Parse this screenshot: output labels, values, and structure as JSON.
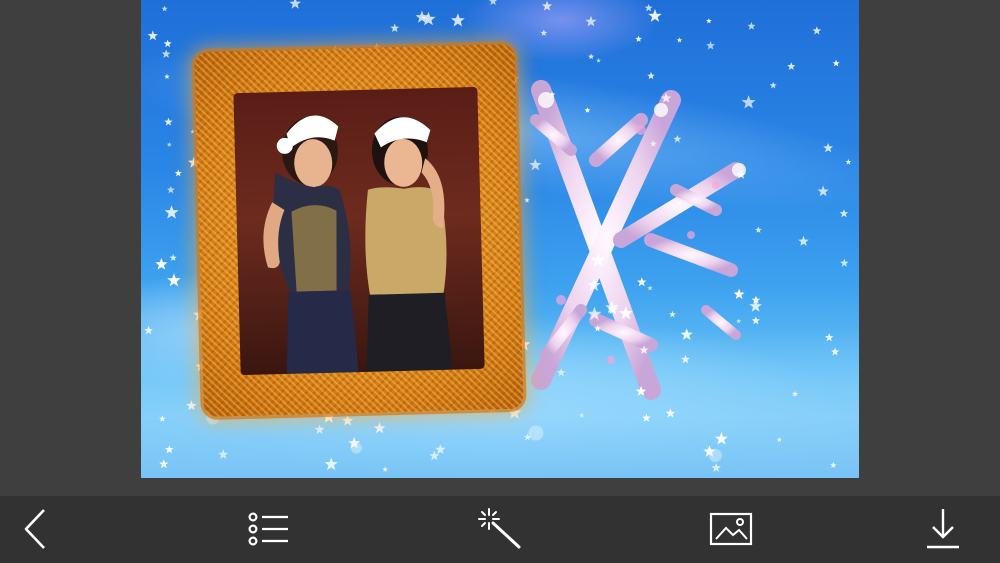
{
  "app": {
    "screen": "frame-preview"
  },
  "canvas": {
    "theme": "winter-snowflake",
    "frame_style": "gold-tinsel",
    "colors": {
      "sky_top": "#1f6fd8",
      "sky_bottom": "#9bd8f8",
      "tinsel": "#e0901f",
      "snowflake": "#f2e2f0",
      "star": "#ffffff"
    }
  },
  "toolbar": {
    "background": "#323232",
    "icon_color": "#ffffff",
    "buttons": [
      {
        "name": "back",
        "icon": "chevron-left-icon"
      },
      {
        "name": "frames-list",
        "icon": "list-icon"
      },
      {
        "name": "effects",
        "icon": "magic-wand-icon"
      },
      {
        "name": "gallery",
        "icon": "image-icon"
      },
      {
        "name": "save",
        "icon": "download-icon"
      }
    ]
  }
}
